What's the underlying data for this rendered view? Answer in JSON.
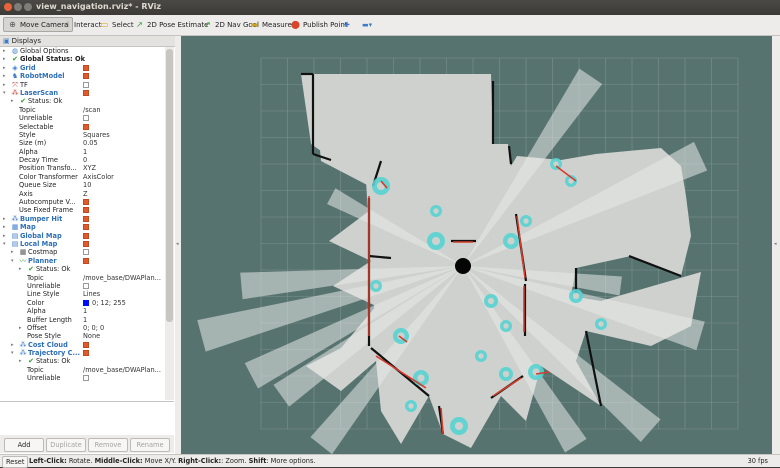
{
  "window": {
    "title": "view_navigation.rviz* - RViz"
  },
  "toolbar": {
    "tools": [
      {
        "label": "Move Camera",
        "icon": "move-camera-icon",
        "glyph": "⊕",
        "color": "#555555",
        "active": true
      },
      {
        "label": "Interact",
        "icon": "interact-icon",
        "glyph": "☝",
        "color": "#333333",
        "active": false
      },
      {
        "label": "Select",
        "icon": "select-icon",
        "glyph": "▭",
        "color": "#d7a400",
        "active": false
      },
      {
        "label": "2D Pose Estimate",
        "icon": "pose-estimate-icon",
        "glyph": "↗",
        "color": "#2aa02a",
        "active": false
      },
      {
        "label": "2D Nav Goal",
        "icon": "nav-goal-icon",
        "glyph": "↗",
        "color": "#2aa02a",
        "active": false
      },
      {
        "label": "Measure",
        "icon": "measure-icon",
        "glyph": "▬",
        "color": "#c9a227",
        "active": false
      },
      {
        "label": "Publish Point",
        "icon": "publish-point-icon",
        "glyph": "⬤",
        "color": "#d9442b",
        "active": false
      }
    ],
    "extra_icons": [
      {
        "icon": "plus-icon",
        "glyph": "✚",
        "color": "#3d7cc9"
      },
      {
        "icon": "minus-dropdown-icon",
        "glyph": "▬▾",
        "color": "#3d7cc9"
      }
    ]
  },
  "displays_panel": {
    "title": "Displays",
    "buttons": {
      "add": "Add",
      "duplicate": "Duplicate",
      "remove": "Remove",
      "rename": "Rename"
    }
  },
  "tree": [
    {
      "level": 0,
      "arrow": "▸",
      "icon": "globe-icon",
      "glyph": "◍",
      "icon_color": "#3d7cc9",
      "label": "Global Options",
      "style": ""
    },
    {
      "level": 0,
      "arrow": "▸",
      "icon": "check-icon",
      "glyph": "✔",
      "icon_color": "#2aa02a",
      "label": "Global Status: Ok",
      "style": "bold"
    },
    {
      "level": 0,
      "arrow": "▸",
      "icon": "grid-icon",
      "glyph": "◈",
      "icon_color": "#3d7cc9",
      "label": "Grid",
      "style": "blue",
      "check": true
    },
    {
      "level": 0,
      "arrow": "▸",
      "icon": "robot-model-icon",
      "glyph": "♞",
      "icon_color": "#3d7cc9",
      "label": "RobotModel",
      "style": "blue",
      "check": true
    },
    {
      "level": 0,
      "arrow": "▸",
      "icon": "tf-icon",
      "glyph": "⤧",
      "icon_color": "#c94a3d",
      "label": "TF",
      "style": "",
      "check": false
    },
    {
      "level": 0,
      "arrow": "▾",
      "icon": "laser-scan-icon",
      "glyph": "⁂",
      "icon_color": "#c94a3d",
      "label": "LaserScan",
      "style": "blue",
      "check": true
    },
    {
      "level": 1,
      "arrow": "▸",
      "icon": "check-icon",
      "glyph": "✔",
      "icon_color": "#2aa02a",
      "label": "Status: Ok",
      "style": ""
    },
    {
      "level": 1,
      "label": "Topic",
      "value": "/scan"
    },
    {
      "level": 1,
      "label": "Unreliable",
      "check": false
    },
    {
      "level": 1,
      "label": "Selectable",
      "check": true
    },
    {
      "level": 1,
      "label": "Style",
      "value": "Squares"
    },
    {
      "level": 1,
      "label": "Size (m)",
      "value": "0.05"
    },
    {
      "level": 1,
      "label": "Alpha",
      "value": "1"
    },
    {
      "level": 1,
      "label": "Decay Time",
      "value": "0"
    },
    {
      "level": 1,
      "label": "Position Transfo...",
      "value": "XYZ"
    },
    {
      "level": 1,
      "label": "Color Transformer",
      "value": "AxisColor"
    },
    {
      "level": 1,
      "label": "Queue Size",
      "value": "10"
    },
    {
      "level": 1,
      "label": "Axis",
      "value": "Z"
    },
    {
      "level": 1,
      "label": "Autocompute V...",
      "check": true
    },
    {
      "level": 1,
      "label": "Use Fixed Frame",
      "check": true
    },
    {
      "level": 0,
      "arrow": "▸",
      "icon": "bumper-hit-icon",
      "glyph": "⁂",
      "icon_color": "#3d7cc9",
      "label": "Bumper Hit",
      "style": "blue",
      "check": true
    },
    {
      "level": 0,
      "arrow": "▸",
      "icon": "map-icon",
      "glyph": "▦",
      "icon_color": "#3d7cc9",
      "label": "Map",
      "style": "blue",
      "check": true
    },
    {
      "level": 0,
      "arrow": "▸",
      "icon": "global-map-icon",
      "glyph": "▤",
      "icon_color": "#3d7cc9",
      "label": "Global Map",
      "style": "blue",
      "check": true
    },
    {
      "level": 0,
      "arrow": "▾",
      "icon": "local-map-icon",
      "glyph": "▤",
      "icon_color": "#3d7cc9",
      "label": "Local Map",
      "style": "blue",
      "check": true
    },
    {
      "level": 1,
      "arrow": "▸",
      "icon": "costmap-icon",
      "glyph": "▦",
      "icon_color": "#555555",
      "label": "Costmap",
      "style": "",
      "check": false
    },
    {
      "level": 1,
      "arrow": "▾",
      "icon": "path-icon",
      "glyph": "〰",
      "icon_color": "#2aa02a",
      "label": "Planner",
      "style": "blue",
      "check": true
    },
    {
      "level": 2,
      "arrow": "▸",
      "icon": "check-icon",
      "glyph": "✔",
      "icon_color": "#2aa02a",
      "label": "Status: Ok",
      "style": ""
    },
    {
      "level": 2,
      "label": "Topic",
      "value": "/move_base/DWAPlan..."
    },
    {
      "level": 2,
      "label": "Unreliable",
      "check": false
    },
    {
      "level": 2,
      "label": "Line Style",
      "value": "Lines"
    },
    {
      "level": 2,
      "label": "Color",
      "swatch": "#000cff",
      "value": "0; 12; 255"
    },
    {
      "level": 2,
      "label": "Alpha",
      "value": "1"
    },
    {
      "level": 2,
      "label": "Buffer Length",
      "value": "1"
    },
    {
      "level": 2,
      "arrow": "▸",
      "label": "Offset",
      "value": "0; 0; 0"
    },
    {
      "level": 2,
      "label": "Pose Style",
      "value": "None"
    },
    {
      "level": 1,
      "arrow": "▸",
      "icon": "cost-cloud-icon",
      "glyph": "⁂",
      "icon_color": "#3d7cc9",
      "label": "Cost Cloud",
      "style": "blue",
      "check": true
    },
    {
      "level": 1,
      "arrow": "▾",
      "icon": "trajectory-cloud-icon",
      "glyph": "⁂",
      "icon_color": "#3d7cc9",
      "label": "Trajectory C...",
      "style": "blue",
      "check": true
    },
    {
      "level": 2,
      "arrow": "▸",
      "icon": "check-icon",
      "glyph": "✔",
      "icon_color": "#2aa02a",
      "label": "Status: Ok",
      "style": ""
    },
    {
      "level": 2,
      "label": "Topic",
      "value": "/move_base/DWAPlan..."
    },
    {
      "level": 2,
      "label": "Unreliable",
      "check": false
    }
  ],
  "status_bar": {
    "reset": "Reset",
    "parts": [
      {
        "text": "Left-Click:",
        "bold": true
      },
      {
        "text": " Rotate. ",
        "bold": false
      },
      {
        "text": "Middle-Click:",
        "bold": true
      },
      {
        "text": " Move X/Y. ",
        "bold": false
      },
      {
        "text": "Right-Click:",
        "bold": true
      },
      {
        "text": ": Zoom. ",
        "bold": false
      },
      {
        "text": "Shift",
        "bold": true
      },
      {
        "text": ": More options.",
        "bold": false
      }
    ],
    "fps": "30 fps"
  },
  "colors": {
    "viewport_bg": "#577370",
    "free_space": "#cfd1cf",
    "obstacle": "#111111",
    "inflation": "#56d3d0",
    "laser": "#d43b2a",
    "grid_line": "#8a9e9b",
    "robot": "#050505"
  }
}
